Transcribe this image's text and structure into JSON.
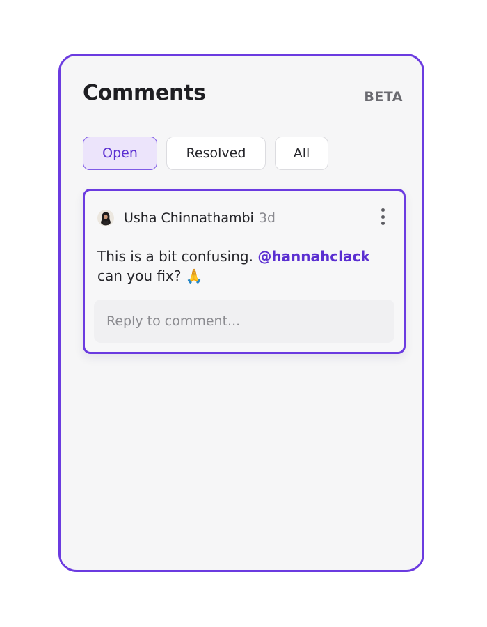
{
  "panel": {
    "title": "Comments",
    "badge": "BETA"
  },
  "tabs": [
    {
      "label": "Open",
      "active": true
    },
    {
      "label": "Resolved",
      "active": false
    },
    {
      "label": "All",
      "active": false
    }
  ],
  "comment": {
    "author": "Usha Chinnathambi",
    "age": "3d",
    "text_before": "This is a bit confusing. ",
    "mention": "@hannahclack",
    "text_after": "can you fix? ",
    "emoji": "🙏",
    "avatar_icon": "avatar",
    "menu_icon": "more-vertical-icon"
  },
  "reply": {
    "placeholder": "Reply to comment..."
  },
  "colors": {
    "accent": "#6b3be0",
    "mention": "#5b2fd1",
    "active_tab_bg": "#ece4fb"
  }
}
